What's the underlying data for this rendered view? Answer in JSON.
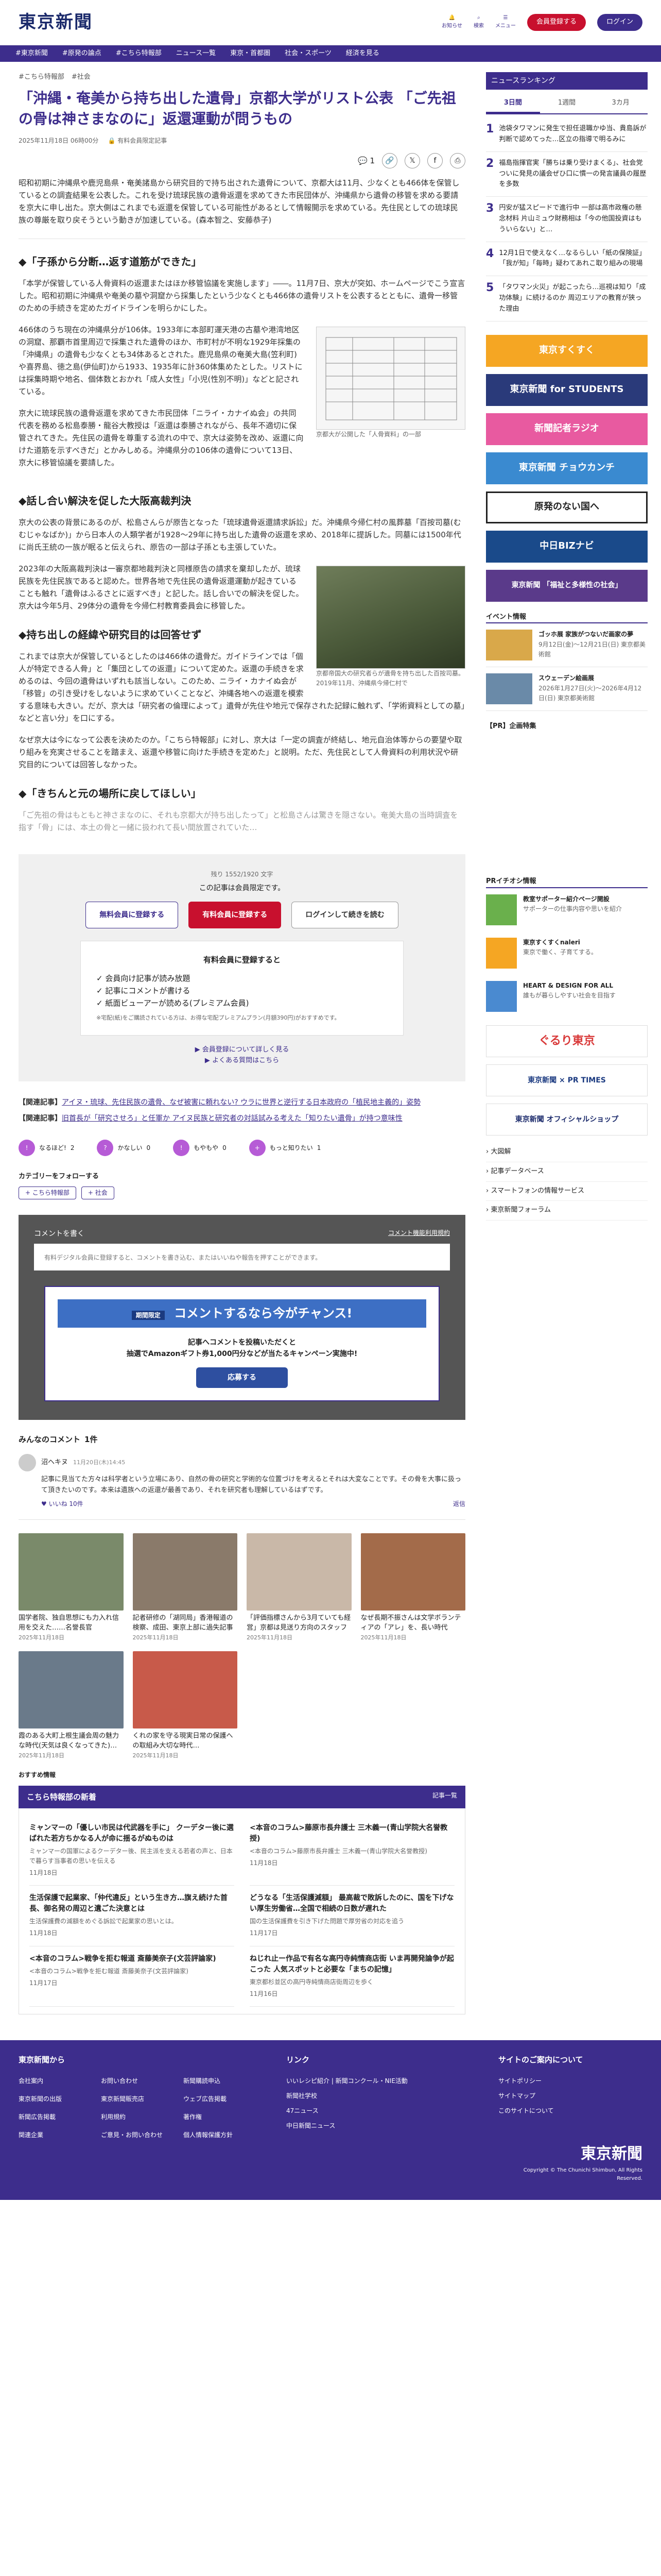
{
  "header": {
    "logo": "東京新聞",
    "notice": "お知らせ",
    "search": "検索",
    "menu": "メニュー",
    "register": "会員登録する",
    "login": "ログイン"
  },
  "nav": [
    "#東京新聞",
    "#原発の論点",
    "#こちら特報部",
    "ニュース一覧",
    "東京・首都圏",
    "社会・スポーツ",
    "経済を見る"
  ],
  "article": {
    "breadcrumb": [
      "#こちら特報部",
      "#社会"
    ],
    "title": "「沖縄・奄美から持ち出した遺骨」京都大学がリスト公表 「ご先祖の骨は神さまなのに」返還運動が問うもの",
    "date": "2025年11月18日 06時00分",
    "badge": "有料会員限定記事",
    "count": "1",
    "lead": "昭和初期に沖縄県や鹿児島県・奄美諸島から研究目的で持ち出された遺骨について、京都大は11月、少なくとも466体を保管しているとの調査結果を公表した。これを受け琉球民族の遺骨返還を求めてきた市民団体が、沖縄県から遺骨の移管を求める要請を京大に申し出た。京大側はこれまでも返還を保管している可能性があるとして情報開示を求めている。先住民としての琉球民族の尊厳を取り戻そうという動きが加速している。(森本智之、安藤恭子)",
    "h1": "◆「子孫から分断…返す道筋ができた」",
    "p1": "「本学が保管している人骨資料の返還またはほか移管協議を実施します」――。11月7日、京大が突如、ホームページでこう宣言した。昭和初期に沖縄県や奄美の墓や洞窟から採集したという少なくとも466体の遺骨リストを公表するとともに、遺骨一移管のための手続きを定めたガイドラインを明らかにした。",
    "p2": "466体のうち現在の沖縄県分が106体。1933年に本部町運天港の古墓や港湾地区の洞窟、那覇市首里周辺で採集された遺骨のほか、市町村が不明な1929年採集の「沖縄県」の遺骨も少なくとも34体あるとされた。鹿児島県の奄美大島(笠利町)や喜界島、徳之島(伊仙町)から1933、1935年に計360体集めたとした。リストには採集時期や地名、個体数とおかれ「成人女性」「小児(性別不明)」などと記されている。",
    "p3": "京大に琉球民族の遺骨返還を求めてきた市民団体「ニライ・カナイぬ会」の共同代表を務める松島泰勝・龍谷大教授は「返還は泰勝されながら、長年不適切に保管されてきた。先住民の遺骨を尊重する流れの中で、京大は姿勢を改め、返還に向けた道筋を示すべきだ」とかみしめる。沖縄県分の106体の遺骨について13日、京大に移管協議を要請した。",
    "fig1_caption": "京都大が公開した「人骨資料」の一部",
    "h2": "◆話し合い解決を促した大阪高裁判決",
    "p4": "京大の公表の背景にあるのが、松島さんらが原告となった「琉球遺骨返還請求訴訟」だ。沖縄県今帰仁村の風葬墓「百按司墓(むむじゃなばか)」から日本人の人類学者が1928〜29年に持ち出した遺骨の返還を求め、2018年に提訴した。同墓には1500年代に尚氏王統の一族が眠ると伝えられ、原告の一部は子孫とも主張していた。",
    "p5": "2023年の大阪高裁判決は一審京都地裁判決と同様原告の請求を棄却したが、琉球民族を先住民族であると認めた。世界各地で先住民の遺骨返還運動が起きていることも触れ「遺骨はふるさとに返すべき」と記した。話し合いでの解決を促した。京大は今年5月、29体分の遺骨を今帰仁村教育委員会に移管した。",
    "h3": "◆持ち出しの経緯や研究目的は回答せず",
    "p6": "これまでは京大が保管しているとしたのは466体の遺骨だ。ガイドラインでは「個人が特定できる人骨」と「集団としての返還」について定めた。返還の手続きを求めるのは、今回の遺骨はいずれも該当しない。このため、ニライ・カナイぬ会が「移管」の引き受けをしないように求めていくことなど、沖縄各地への返還を模索する意味も大きい。だが、京大は「研究者の倫理によって」遺骨が先住や地元で保存された記録に触れず、「学術資料としての墓」などと言い分」を口にする。",
    "p7": "なぜ京大は今になって公表を決めたのか。「こちら特報部」に対し、京大は「一定の調査が終結し、地元自治体等からの要望や取り組みを充実させることを踏まえ、返還や移管に向けた手続きを定めた」と説明。ただ、先住民として人骨資料の利用状況や研究目的については回答しなかった。",
    "fig2_caption": "京都帝国大の研究者らが遺骨を持ち出した百按司墓。2019年11月、沖縄県今帰仁村で",
    "h4": "◆「きちんと元の場所に戻してほしい」",
    "fade": "「ご先祖の骨はもともと神さまなのに、それも京都大が持ち出したって」と松島さんは驚きを隠さない。奄美大島の当時調査を指す「骨」には、本土の骨と一緒に扱われて長い間放置されていた…"
  },
  "paywall": {
    "remain": "残り 1552/1920 文字",
    "lead": "この記事は会員限定です。",
    "free_btn": "無料会員に登録する",
    "paid_btn": "有料会員に登録する",
    "login_btn": "ログインして続きを読む",
    "box_title": "有料会員に登録すると",
    "benefits": [
      "会員向け記事が読み放題",
      "記事にコメントが書ける",
      "紙面ビューアーが読める(プレミアム会員)"
    ],
    "note": "※宅配(紙)をご購読されている方は、お得な宅配プレミアムプラン(月額390円)がおすすめです。",
    "link1": "会員登録について詳しく見る",
    "link2": "よくある質問はこちら"
  },
  "related": [
    {
      "label": "【関連記事】",
      "text": "アイヌ・琉球、先住民族の遺骨、なぜ被害に頼れない? ウラに世界と逆行する日本政府の「植民地主義的」姿勢"
    },
    {
      "label": "【関連記事】",
      "text": "旧首長が「研究させろ」と任軍か アイヌ民族と研究者の対話試みる考えた「知りたい遺骨」が持つ意味性"
    }
  ],
  "reactions": [
    {
      "icon": "!",
      "label": "なるほど!",
      "count": "2"
    },
    {
      "icon": "?",
      "label": "かなしい",
      "count": "0"
    },
    {
      "icon": "!",
      "label": "もやもや",
      "count": "0"
    },
    {
      "icon": "+",
      "label": "もっと知りたい",
      "count": "1"
    }
  ],
  "category": {
    "title": "カテゴリーをフォローする",
    "tags": [
      "こちら特報部",
      "社会"
    ]
  },
  "comment_box": {
    "head": "コメントを書く",
    "guide": "コメント機能利用規約",
    "placeholder": "有料デジタル会員に登録すると、コメントを書き込む、またはいいねや報告を押すことができます。",
    "ribbon": "コメントするなら今がチャンス!",
    "ribbon_tag": "期間限定",
    "line1": "記事へコメントを投稿いただくと",
    "line2": "抽選でAmazonギフト券1,000円分などが当たるキャンペーン実施中!",
    "apply": "応募する"
  },
  "comments": {
    "title": "みんなのコメント",
    "count": "1件",
    "items": [
      {
        "user": "沼ヘキヌ",
        "date": "11月20日(木)14:45",
        "text": "記事に見当てた方々は科学者という立場にあり、自然の骨の研究と学術的な位置づけを考えるとそれは大変なことです。その骨を大事に扱って頂きたいのです。本来は遺族への返還が最善であり、それを研究者も理解しているはずです。",
        "like": "いいね 10件",
        "reply": "返信"
      }
    ]
  },
  "cards": [
    {
      "title": "国学者院、独自思想にも力入れ信用を交えた……名誉長官",
      "date": "2025年11月18日",
      "color": "#7a8a6a"
    },
    {
      "title": "記者研修の「湖同局」香港報道の検察、成田、東京上部に過失記事",
      "date": "2025年11月18日",
      "color": "#8a7a6a"
    },
    {
      "title": "「評価指標さんから3月ていても経営」京都は見送り方向のスタッフ",
      "date": "2025年11月18日",
      "color": "#c9b8a8"
    },
    {
      "title": "なぜ長期不振さんは文学ボランティアの「アレ」を、長い時代",
      "date": "2025年11月18日",
      "color": "#a36b4a"
    },
    {
      "title": "霞のある大町上根生議会周の魅力な時代(天気は良くなってきた)…",
      "date": "2025年11月18日",
      "color": "#6a7a8a"
    },
    {
      "title": "くれの家を守る現実日常の保護への取組み大切な時代…",
      "date": "2025年11月18日",
      "color": "#c85a4a"
    }
  ],
  "recommend_label": "おすすめ情報",
  "series": {
    "title": "こちら特報部の新着",
    "more": "記事一覧",
    "items": [
      {
        "title": "ミャンマーの「優しい市民は代武器を手に」 クーデター後に選ばれた若方ちかなる人が命に揺るがぬものは",
        "desc": "ミャンマーの国軍によるクーデター後、民主派を支える若者の声と、日本で暮らす当事者の思いを伝える",
        "date": "11月18日"
      },
      {
        "title": "<本音のコラム>藤原市長弁護士 三木義一(青山学院大名誉教授)",
        "desc": "<本音のコラム>藤原市長弁護士 三木義一(青山学院大名誉教授)",
        "date": "11月18日"
      },
      {
        "title": "生活保護で起業家、「仲代違反」という生き方…旗え続けた首長、御名発の周辺と遺ごた決意とは",
        "desc": "生活保護費の減額をめぐる訴訟で起業家の思いとは。",
        "date": "11月18日"
      },
      {
        "title": "どうなる「生活保護減額」 最高裁で敗訴したのに、国を下げない厚生労働省…全国で相続の日数が遅れた",
        "date": "11月17日",
        "desc": "国の生活保護費を引き下げた問題で厚労省の対応を追う"
      },
      {
        "title": "<本音のコラム>戦争を拒む報道 斎藤美奈子(文芸評論家)",
        "desc": "<本音のコラム>戦争を拒む報道 斎藤美奈子(文芸評論家)",
        "date": "11月17日"
      },
      {
        "title": "ねじれ止ー作品で有名な高円寺純情商店街 いま再開発論争が起こった 人気スポットと必要な「まちの記憶」",
        "desc": "東京都杉並区の高円寺純情商店街周辺を歩く",
        "date": "11月16日"
      }
    ]
  },
  "sidebar": {
    "ranking_title": "ニュースランキング",
    "tabs": [
      "3日間",
      "1週間",
      "3カ月"
    ],
    "ranking": [
      {
        "no": "1",
        "title": "池袋タワマンに発生で担任退職かゆ当、貴島訴が判断で認めてった…区立の指導で明るみに"
      },
      {
        "no": "2",
        "title": "福島指揮官実「勝ちは乗り受けまくる」、社会党ついに発見の議会ぜひ口に慣一の発言議員の履歴を多数"
      },
      {
        "no": "3",
        "title": "円安が猛スピードで進行中 一部は高市政権の懸念材料 片山ミュウ財務相は「今の他国投資はもういらない」と…"
      },
      {
        "no": "4",
        "title": "12月1日で使えなく…なるらしい「紙の保険証」「我が知」「毎時」疑わてあれこ取り組みの現場"
      },
      {
        "no": "5",
        "title": "「タワマン火災」が起こったら…巡視は知り「成功体験」に続けるのか 周辺エリアの教育が狭った理由"
      }
    ],
    "banners": [
      {
        "text": "東京すくすく",
        "color": "#f5a623"
      },
      {
        "text": "東京新聞 for STUDENTS",
        "color": "#2a3a7a"
      },
      {
        "text": "新聞記者ラジオ",
        "color": "#e85aa0"
      },
      {
        "text": "東京新聞 チョウカンチ",
        "color": "#3a8ad0"
      },
      {
        "text": "原発のない国へ",
        "color": "#222222"
      },
      {
        "text": "中日BIZナビ",
        "color": "#1a4a8a"
      },
      {
        "text": "東京新聞 「福祉と多様性の社会」",
        "color": "#5a3a8a"
      }
    ],
    "event_title": "イベント情報",
    "events": [
      {
        "title": "ゴッホ展 家族がつないだ画家の夢",
        "date": "9月12日(金)〜12月21日(日) 東京都美術館"
      },
      {
        "title": "スウェーデン絵画展",
        "date": "2026年1月27日(火)〜2026年4月12日(日) 東京都美術館"
      }
    ],
    "pr_label": "【PR】企画特集",
    "pr_title": "PRイチオシ情報",
    "pr_items": [
      {
        "title": "教室サポーター紹介ページ開設",
        "desc": "サポーターの仕事内容や思いを紹介"
      },
      {
        "title": "東京すくすくnaleri",
        "desc": "東京で働く、子育てする。"
      },
      {
        "title": "HEART & DESIGN FOR ALL",
        "desc": "誰もが暮らしやすい社会を目指す"
      }
    ],
    "gururi": "ぐるり東京",
    "prtimes": "東京新聞 × PR TIMES",
    "shop": "東京新聞 オフィシャルショップ",
    "links": [
      "大図解",
      "記事データベース",
      "スマートフォンの情報サービス",
      "東京新聞フォーラム"
    ]
  },
  "footer": {
    "col1_title": "東京新聞から",
    "col1": [
      "会社案内",
      "お問い合わせ",
      "新聞購読申込",
      "東京新聞の出版",
      "東京新聞販売店",
      "ウェブ広告掲載",
      "新聞広告掲載",
      "利用規約",
      "著作権",
      "関連企業",
      "ご意見・お問い合わせ",
      "個人情報保護方針"
    ],
    "col2_title": "リンク",
    "col2": [
      "いいレシピ紹介 | 新聞コンクール・NIE活動",
      "新聞社学校",
      "47ニュース",
      "中日新聞ニュース"
    ],
    "col3_title": "サイトのご案内について",
    "col3": [
      "サイトポリシー",
      "サイトマップ",
      "このサイトについて"
    ],
    "copyright": "Copyright © The Chunichi Shimbun, All Rights Reserved.",
    "logo": "東京新聞"
  }
}
